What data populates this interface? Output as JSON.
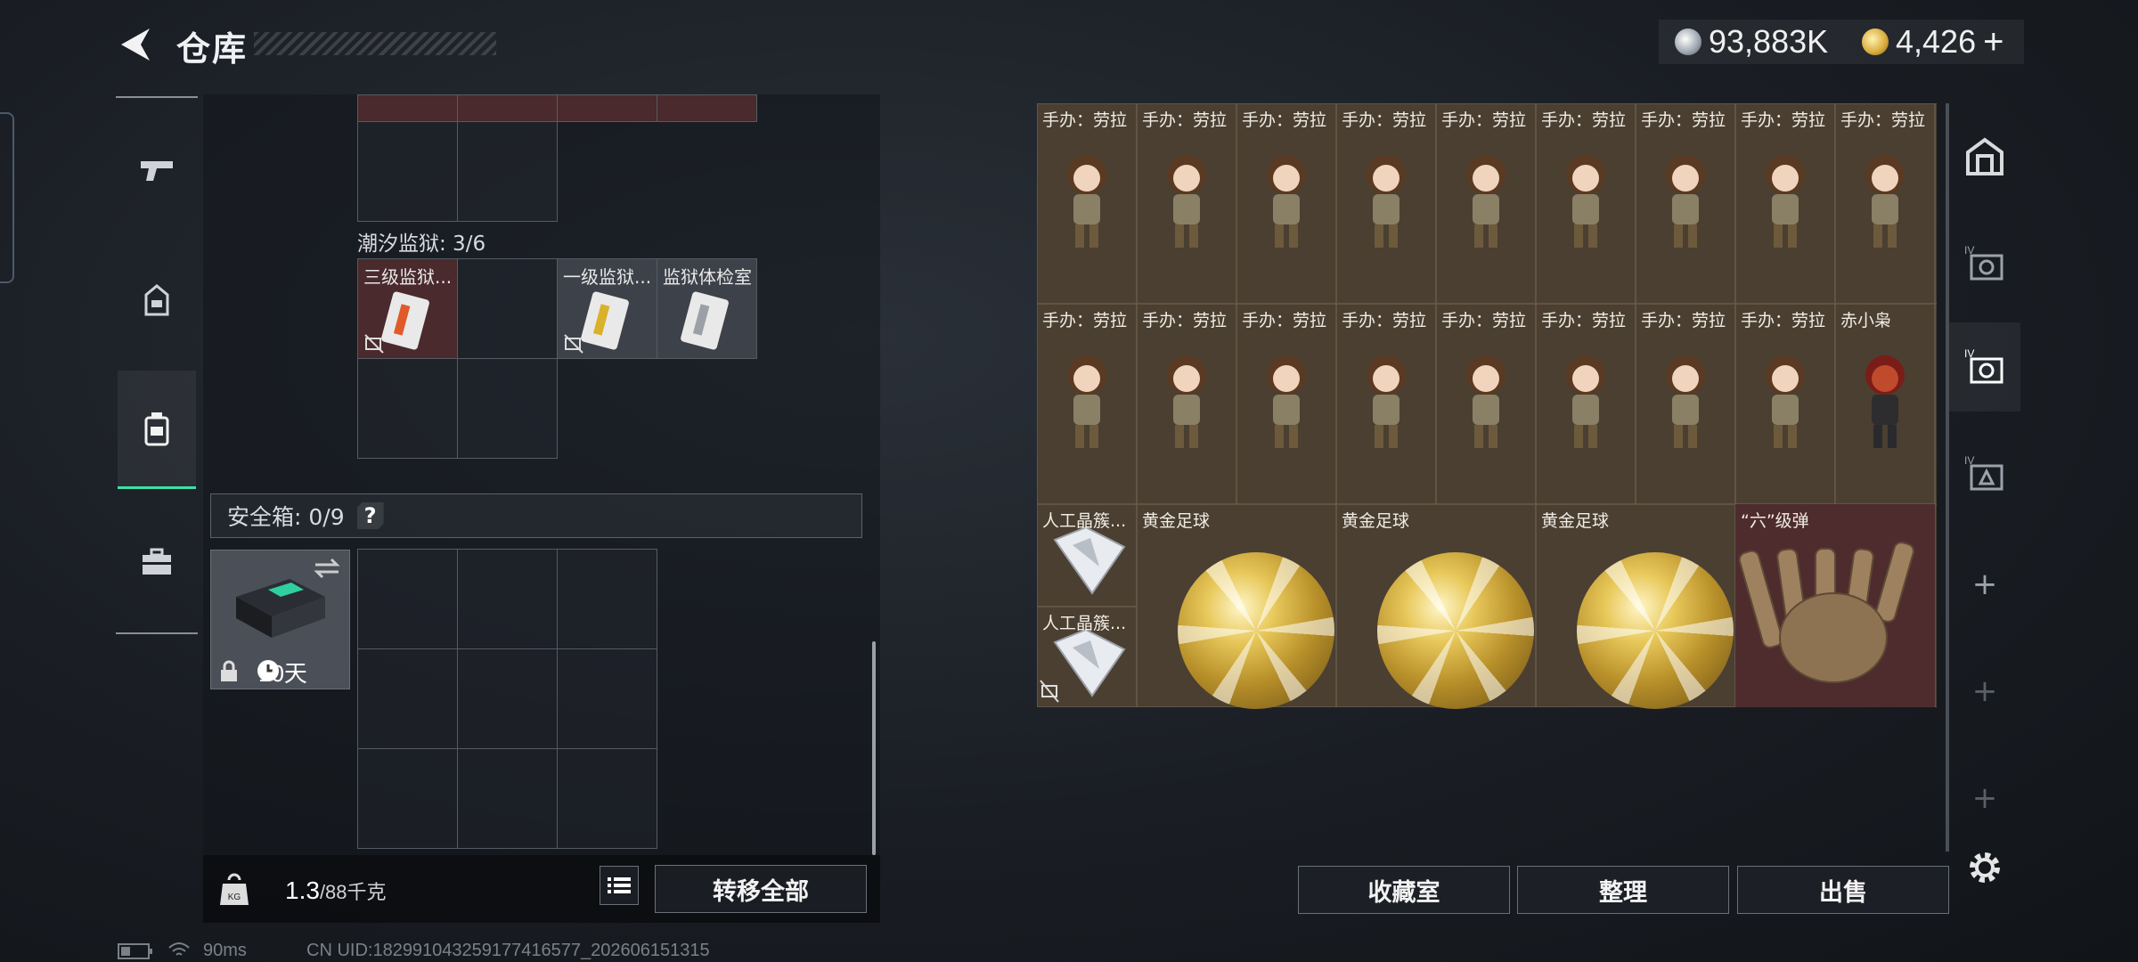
{
  "header": {
    "title": "仓库"
  },
  "currency": {
    "silver": "93,883K",
    "gold": "4,426",
    "plus": "+"
  },
  "left_rail": [
    {
      "name": "weapons-tab",
      "icon": "pistol-icon"
    },
    {
      "name": "armor-tab",
      "icon": "helmet-icon"
    },
    {
      "name": "backpack-tab",
      "icon": "backpack-icon",
      "active": true
    },
    {
      "name": "case-tab",
      "icon": "toolbox-icon"
    }
  ],
  "inventory": {
    "prison_label": "潮汐监狱: 3/6",
    "prison_items": [
      "三级监狱...",
      "一级监狱...",
      "监狱体检室"
    ],
    "safe_label": "安全箱: 0/9",
    "safe_help": "?",
    "safe_duration": "10天"
  },
  "footer_left": {
    "weight": "1.3",
    "weight_cap": "/88千克",
    "transfer_all": "转移全部"
  },
  "storage": {
    "row1": [
      "手办：劳拉",
      "手办：劳拉",
      "手办：劳拉",
      "手办：劳拉",
      "手办：劳拉",
      "手办：劳拉",
      "手办：劳拉",
      "手办：劳拉",
      "手办：劳拉"
    ],
    "row2": [
      "手办：劳拉",
      "手办：劳拉",
      "手办：劳拉",
      "手办：劳拉",
      "手办：劳拉",
      "手办：劳拉",
      "手办：劳拉",
      "手办：劳拉",
      "赤小枭"
    ],
    "crystal_1": "人工晶簇...",
    "crystal_2": "人工晶簇...",
    "balls": [
      "黄金足球",
      "黄金足球",
      "黄金足球"
    ],
    "bullet": "“六”级弹"
  },
  "footer_right": {
    "collection": "收藏室",
    "sort": "整理",
    "sell": "出售"
  },
  "right_tabs": [
    "vault-icon",
    "iv-tab-1",
    "iv-tab-2",
    "iv-tab-3"
  ],
  "right_tabs_plus": "+",
  "status": {
    "ping": "90ms",
    "uid": "CN UID:1829910432591774165​77_202606151315"
  }
}
